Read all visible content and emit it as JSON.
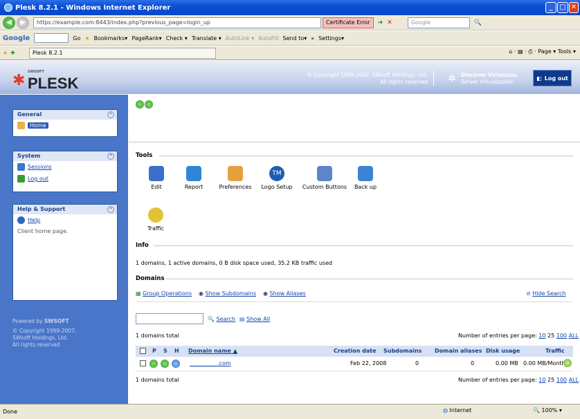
{
  "window": {
    "title": "Plesk 8.2.1 - Windows Internet Explorer",
    "minimize": "_",
    "maximize": "□",
    "close": "✕"
  },
  "address_bar": {
    "url": "https://example.com:8443/index.php?previous_page=login_up",
    "cert_error": "Certificate Error",
    "search_placeholder": "Google"
  },
  "google_toolbar": {
    "logo": "Google",
    "go": "Go",
    "bookmarks": "Bookmarks▾",
    "pagerank": "PageRank▾",
    "check": "Check ▾",
    "translate": "Translate ▾",
    "autolink": "AutoLink ▾",
    "autofill": "AutoFill",
    "send_to": "Send to▾",
    "more": "»",
    "settings": "Settings▾"
  },
  "fav_bar": {
    "tab_title": "Plesk 8.2.1",
    "page_menu": "Page ▾",
    "tools_menu": "Tools ▾"
  },
  "header": {
    "logo_small": "SWSOFT",
    "logo": "PLESK",
    "copyright_line1": "© Copyright 1999-2007, SWsoft Holdings, Ltd.",
    "copyright_line2": "All rights reserved",
    "discover_line1": "Discover Virtuozzo,",
    "discover_line2": "Server Virtualization",
    "logout": "Log out"
  },
  "sidebar": {
    "general": {
      "title": "General",
      "items": [
        {
          "label": "Home"
        }
      ]
    },
    "system": {
      "title": "System",
      "items": [
        {
          "label": "Sessions"
        },
        {
          "label": "Log out"
        }
      ]
    },
    "help": {
      "title": "Help & Support",
      "items": [
        {
          "label": "Help"
        }
      ],
      "text": "Client home page."
    },
    "footer": {
      "powered_by": "Powered by",
      "brand": "SWSOFT",
      "copy1": "© Copyright 1999-2007,",
      "copy2": "SWsoft Holdings, Ltd.",
      "copy3": "All rights reserved"
    }
  },
  "main": {
    "tools_title": "Tools",
    "tools": [
      {
        "label": "Edit",
        "color": "#3b6fc9"
      },
      {
        "label": "Report",
        "color": "#2f86d6"
      },
      {
        "label": "Preferences",
        "color": "#e6a13c"
      },
      {
        "label": "Logo Setup",
        "color": "#1b5fb2"
      },
      {
        "label": "Custom Buttons",
        "color": "#5d86c9"
      },
      {
        "label": "Back up",
        "color": "#3e83d3"
      },
      {
        "label": "Traffic",
        "color": "#e4c236"
      }
    ],
    "info_title": "Info",
    "info_text": "1 domains, 1 active domains, 0 B disk space used, 35.2 KB traffic used",
    "domains_title": "Domains",
    "group_operations": "Group Operations",
    "show_subdomains": "Show Subdomains",
    "show_aliases": "Show Aliases",
    "hide_search": "Hide Search",
    "search_button": "Search",
    "show_all": "Show All",
    "domains_total": "1 domains total",
    "entries_per_page_label": "Number of entries per page:",
    "entries_options": [
      "10",
      "25",
      "100",
      "ALL"
    ],
    "table": {
      "headers": {
        "p": "P",
        "s": "S",
        "h": "H",
        "domain": "Domain name ▲",
        "creation": "Creation date",
        "subdomains": "Subdomains",
        "aliases": "Domain aliases",
        "disk": "Disk usage",
        "traffic": "Traffic"
      },
      "rows": [
        {
          "domain": "__________.com",
          "creation": "Feb 22, 2008",
          "subdomains": "0",
          "aliases": "0",
          "disk": "0.00 MB",
          "traffic": "0.00 MB/Month"
        }
      ]
    }
  },
  "statusbar": {
    "left": "Done",
    "zone": "Internet",
    "zoom": "100%"
  }
}
